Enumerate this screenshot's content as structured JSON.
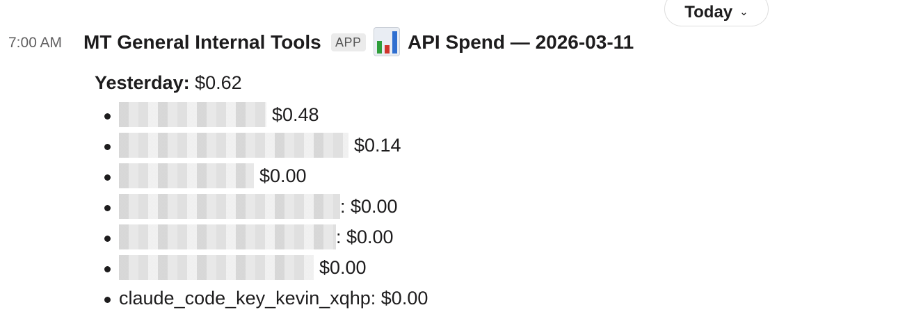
{
  "header": {
    "date_divider": {
      "label": "Today",
      "chevron": "chevron-down-icon"
    }
  },
  "message": {
    "timestamp": "7:00 AM",
    "sender": "MT General Internal Tools",
    "app_badge": "APP",
    "title_icon": "bar-chart-emoji-icon",
    "title": "API Spend — 2026-03-11",
    "summary_label": "Yesterday:",
    "summary_value": "$0.62",
    "items": [
      {
        "name": "",
        "name_redacted": true,
        "amount": "$0.48"
      },
      {
        "name": "",
        "name_redacted": true,
        "amount": "$0.14"
      },
      {
        "name": "",
        "name_redacted": true,
        "amount": "$0.00"
      },
      {
        "name": "",
        "name_redacted": true,
        "amount": ": $0.00"
      },
      {
        "name": "",
        "name_redacted": true,
        "amount": ": $0.00"
      },
      {
        "name": "",
        "name_redacted": true,
        "amount": "$0.00"
      },
      {
        "name": "claude_code_key_kevin_xqhp",
        "name_redacted": false,
        "amount": ": $0.00"
      }
    ]
  },
  "colors": {
    "text": "#1d1c1d",
    "muted": "#616061",
    "badge_bg": "#ebebeb",
    "chart_green": "#2e9e3a",
    "chart_red": "#d0342c",
    "chart_blue": "#2f6fd0"
  }
}
